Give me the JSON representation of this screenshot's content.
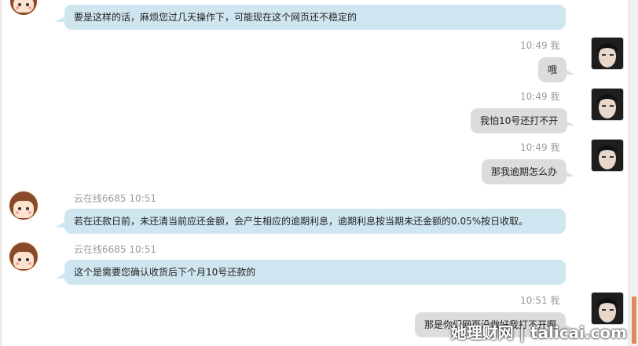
{
  "messages": [
    {
      "id": "m1",
      "sender": "agent",
      "name": "",
      "time": "",
      "text": "要是这样的话，麻烦您过几天操作下，可能现在这个网页还不稳定的"
    },
    {
      "id": "m2",
      "sender": "me",
      "name": "我",
      "time": "10:49",
      "text": "哦"
    },
    {
      "id": "m3",
      "sender": "me",
      "name": "我",
      "time": "10:49",
      "text": "我怕10号还打不开"
    },
    {
      "id": "m4",
      "sender": "me",
      "name": "我",
      "time": "10:49",
      "text": "那我逾期怎么办"
    },
    {
      "id": "m5",
      "sender": "agent",
      "name": "云在线6685",
      "time": "10:51",
      "text": "若在还款日前，未还清当前应还金额，会产生相应的逾期利息，逾期利息按当期未还金额的0.05%按日收取。"
    },
    {
      "id": "m6",
      "sender": "agent",
      "name": "云在线6685",
      "time": "10:51",
      "text": "这个是需要您确认收货后下个月10号还款的"
    },
    {
      "id": "m7",
      "sender": "me",
      "name": "我",
      "time": "10:51",
      "text": "那是你们网页没做好我打不开啊"
    }
  ],
  "watermark": "她理财网 | talicai.com",
  "colors": {
    "agent_bubble": "#cfe6f1",
    "my_bubble": "#dcdcdc",
    "meta_text": "#999999",
    "scroll_thumb": "#e0895a"
  },
  "icons": {
    "agent_avatar": "cartoon-girl-avatar",
    "my_avatar": "portrait-avatar"
  }
}
